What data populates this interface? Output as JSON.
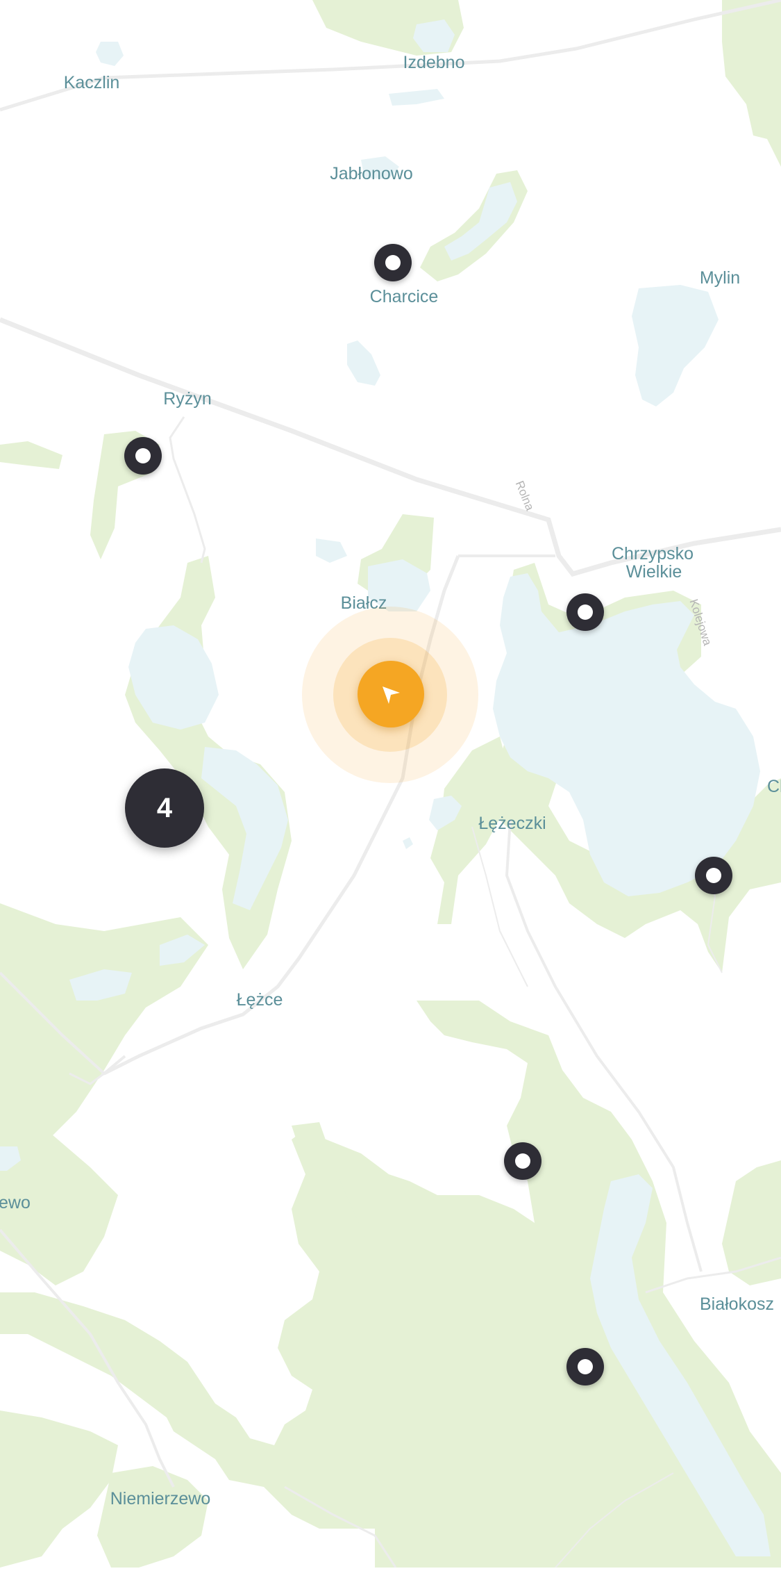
{
  "map": {
    "colors": {
      "land": "#ffffff",
      "forest": "#e5f1d5",
      "water": "#e7f3f6",
      "road": "#ececec",
      "label": "#5b8f99",
      "marker": "#2e2d35",
      "location": "#f5a623"
    },
    "place_labels": {
      "kaczlin": "Kaczlin",
      "izdebno": "Izdebno",
      "jablonowo": "Jabłonowo",
      "charcice": "Charcice",
      "mylin": "Mylin",
      "ryzyn": "Ryżyn",
      "bialcz": "Białcz",
      "chrzypsko_line1": "Chrzypsko",
      "chrzypsko_line2": "Wielkie",
      "lezeczki": "Łężeczki",
      "lezce": "Łężce",
      "ewo": "ewo",
      "bialokosz": "Białokosz",
      "niemierzewo": "Niemierzewo",
      "ch": "Ch"
    },
    "road_labels": {
      "rolna": "Rolna",
      "kolejowa": "Kolejowa"
    },
    "cluster": {
      "count": "4"
    },
    "current_location": {
      "icon": "navigation-arrow-icon"
    },
    "marker_count": 6
  }
}
